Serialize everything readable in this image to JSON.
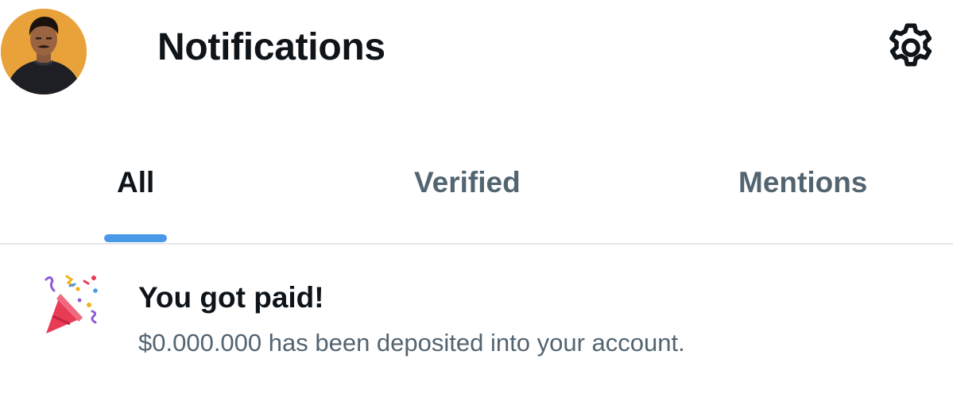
{
  "header": {
    "title": "Notifications",
    "avatar_icon": "profile-photo",
    "settings_icon": "gear-icon"
  },
  "tabs": [
    {
      "label": "All",
      "selected": true
    },
    {
      "label": "Verified",
      "selected": false
    },
    {
      "label": "Mentions",
      "selected": false
    }
  ],
  "notifications": [
    {
      "icon": "party-popper-icon",
      "title": "You got paid!",
      "body": "$0.000.000 has been deposited into your account."
    }
  ],
  "colors": {
    "text_primary": "#0f1419",
    "text_secondary": "#536471",
    "tab_indicator": "#4a99e9",
    "avatar_bg": "#e9a23a"
  }
}
